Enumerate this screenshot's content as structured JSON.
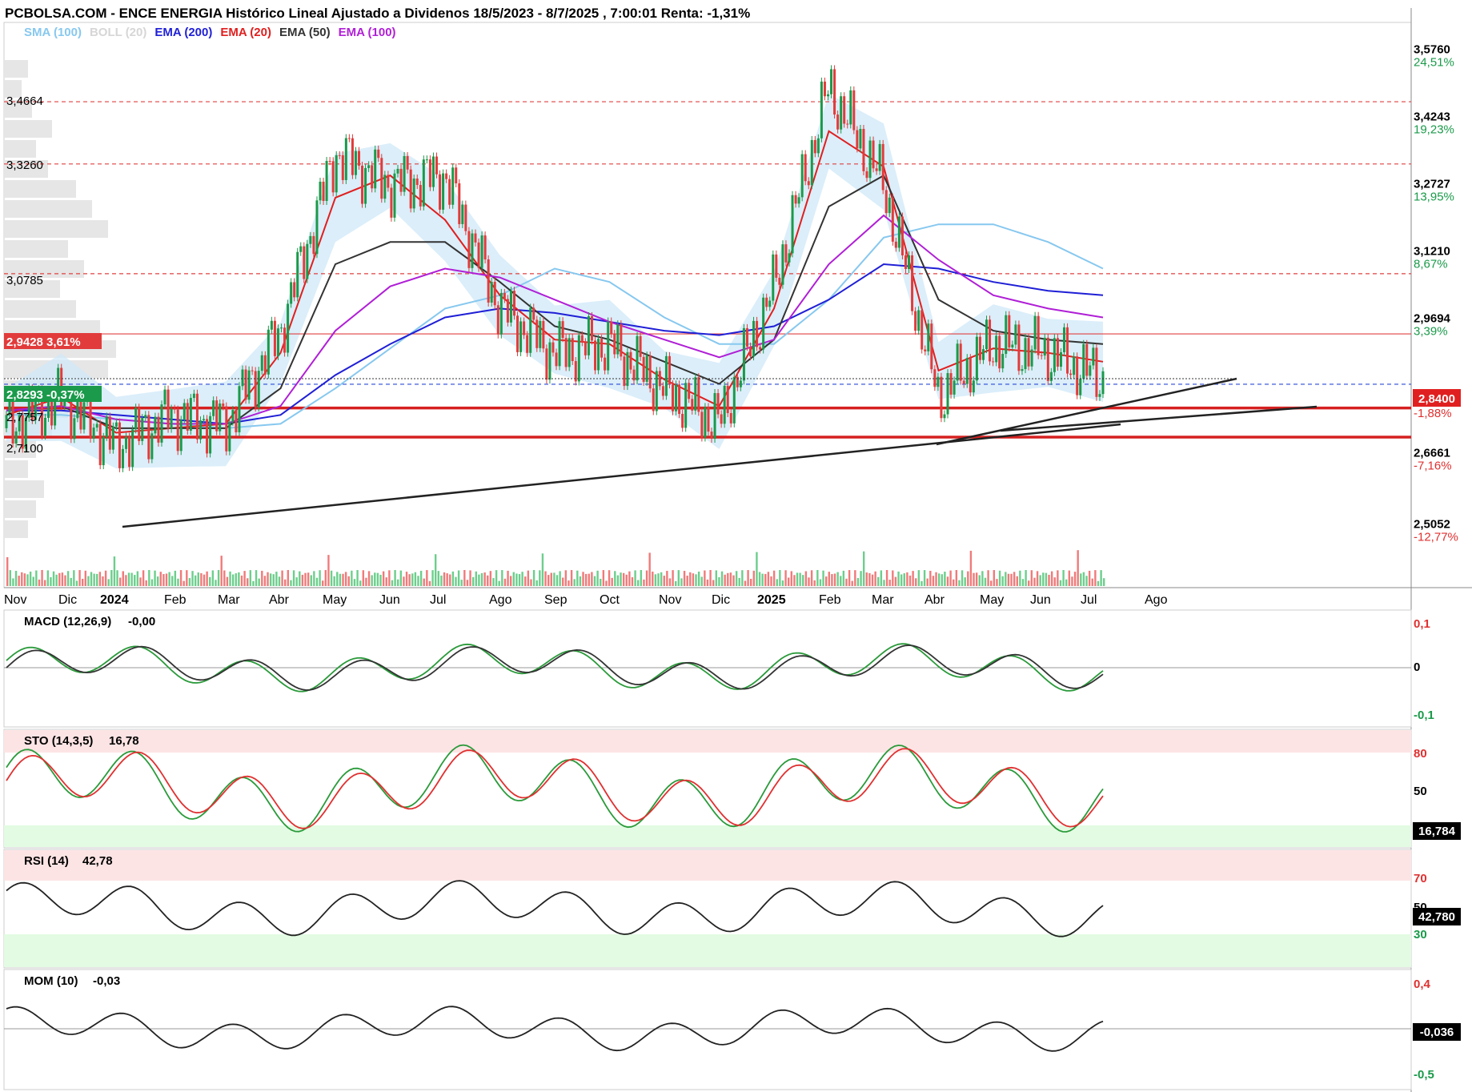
{
  "title": "PCBOLSA.COM - ENCE ENERGIA Histórico Lineal Ajustado a Dividenos 18/5/2023 - 8/7/2025 , 7:00:01 Renta: -1,31%",
  "legend": [
    {
      "label": "SMA (100)",
      "color": "#87c8ef"
    },
    {
      "label": "BOLL (20)",
      "color": "#d6d6d6"
    },
    {
      "label": "EMA (200)",
      "color": "#1f1fd6"
    },
    {
      "label": "EMA (20)",
      "color": "#e01f1f"
    },
    {
      "label": "EMA (50)",
      "color": "#333333"
    },
    {
      "label": "EMA (100)",
      "color": "#b01fd6"
    }
  ],
  "right_axis": [
    {
      "price": "3,5760",
      "pct": "24,51%",
      "pct_color": "#1a9a4a"
    },
    {
      "price": "3,4243",
      "pct": "19,23%",
      "pct_color": "#1a9a4a"
    },
    {
      "price": "3,2727",
      "pct": "13,95%",
      "pct_color": "#1a9a4a"
    },
    {
      "price": "3,1210",
      "pct": "8,67%",
      "pct_color": "#1a9a4a"
    },
    {
      "price": "2,9694",
      "pct": "3,39%",
      "pct_color": "#1a9a4a"
    },
    {
      "price": "2,6661",
      "pct": "-7,16%",
      "pct_color": "#e03030"
    },
    {
      "price": "2,5052",
      "pct": "-12,77%",
      "pct_color": "#e03030"
    }
  ],
  "current_price": {
    "price": "2,8400",
    "pct": "-1,88%"
  },
  "levels": [
    {
      "label": "3,4664",
      "style": "dashed-red"
    },
    {
      "label": "3,3260",
      "style": "dashed-red"
    },
    {
      "label": "3,0785",
      "style": "dashed-red"
    },
    {
      "label": "2,9428 3,61%",
      "style": "solid-red-box"
    },
    {
      "label": "2,8293 -0,37%",
      "style": "green-box"
    },
    {
      "label": "2,7757",
      "style": "thick-red"
    },
    {
      "label": "2,7100",
      "style": "thick-red"
    }
  ],
  "x_months": [
    "Nov",
    "Dic",
    "2024",
    "Feb",
    "Mar",
    "Abr",
    "May",
    "Jun",
    "Jul",
    "Ago",
    "Sep",
    "Oct",
    "Nov",
    "Dic",
    "2025",
    "Feb",
    "Mar",
    "Abr",
    "May",
    "Jun",
    "Jul",
    "Ago"
  ],
  "x_year_labels": [
    "2024",
    "2025"
  ],
  "macd": {
    "title": "MACD (12,26,9)",
    "value": "-0,00",
    "ticks": [
      "0,1",
      "0",
      "-0,1"
    ]
  },
  "sto": {
    "title": "STO (14,3,5)",
    "value": "16,78",
    "ticks": [
      "80",
      "50"
    ],
    "last": "16,784"
  },
  "rsi": {
    "title": "RSI (14)",
    "value": "42,78",
    "ticks": [
      "70",
      "50",
      "30"
    ],
    "last": "42,780"
  },
  "mom": {
    "title": "MOM (10)",
    "value": "-0,03",
    "ticks": [
      "0,4",
      "-0,5"
    ],
    "last": "-0,036"
  },
  "chart_data": {
    "type": "line",
    "title": "PCBOLSA.COM - ENCE ENERGIA Histórico Lineal Ajustado a Dividenos 18/5/2023 - 8/7/2025 , 7:00:01 Renta: -1,31%",
    "x": [
      "2023-11",
      "2023-12",
      "2024-01",
      "2024-02",
      "2024-03",
      "2024-04",
      "2024-05",
      "2024-06",
      "2024-07",
      "2024-08",
      "2024-09",
      "2024-10",
      "2024-11",
      "2024-12",
      "2025-01",
      "2025-02",
      "2025-03",
      "2025-04",
      "2025-05",
      "2025-06",
      "2025-07"
    ],
    "series": [
      {
        "name": "Close",
        "values": [
          2.73,
          2.8,
          2.69,
          2.76,
          2.74,
          2.95,
          3.35,
          3.28,
          3.3,
          3.0,
          2.9,
          2.92,
          2.82,
          2.74,
          3.05,
          3.5,
          3.28,
          2.8,
          2.92,
          2.9,
          2.84
        ]
      },
      {
        "name": "SMA (100)",
        "values": [
          2.76,
          2.76,
          2.75,
          2.74,
          2.73,
          2.74,
          2.82,
          2.91,
          3.0,
          3.03,
          3.09,
          3.06,
          2.98,
          2.92,
          2.92,
          3.02,
          3.16,
          3.19,
          3.19,
          3.15,
          3.09
        ]
      },
      {
        "name": "EMA (200)",
        "values": [
          2.77,
          2.77,
          2.76,
          2.75,
          2.74,
          2.76,
          2.85,
          2.92,
          2.98,
          3.0,
          2.99,
          2.97,
          2.95,
          2.94,
          2.96,
          3.02,
          3.1,
          3.09,
          3.06,
          3.04,
          3.03
        ]
      },
      {
        "name": "EMA (20)",
        "values": [
          2.76,
          2.8,
          2.72,
          2.73,
          2.74,
          2.9,
          3.25,
          3.3,
          3.2,
          3.03,
          2.93,
          2.92,
          2.84,
          2.78,
          3.0,
          3.4,
          3.32,
          2.86,
          2.91,
          2.9,
          2.88
        ]
      },
      {
        "name": "EMA (50)",
        "values": [
          2.77,
          2.78,
          2.73,
          2.73,
          2.73,
          2.82,
          3.1,
          3.15,
          3.15,
          3.06,
          2.96,
          2.93,
          2.88,
          2.83,
          2.93,
          3.23,
          3.3,
          3.02,
          2.95,
          2.93,
          2.92
        ]
      },
      {
        "name": "EMA (100)",
        "values": [
          2.77,
          2.78,
          2.75,
          2.74,
          2.74,
          2.78,
          2.95,
          3.05,
          3.09,
          3.07,
          3.02,
          2.97,
          2.93,
          2.89,
          2.93,
          3.1,
          3.21,
          3.11,
          3.03,
          3.0,
          2.98
        ]
      }
    ],
    "y_ticks": [
      "3,5760",
      "3,4243",
      "3,2727",
      "3,1210",
      "2,9694",
      "2,6661",
      "2,5052"
    ],
    "ylim": [
      2.45,
      3.62
    ]
  }
}
